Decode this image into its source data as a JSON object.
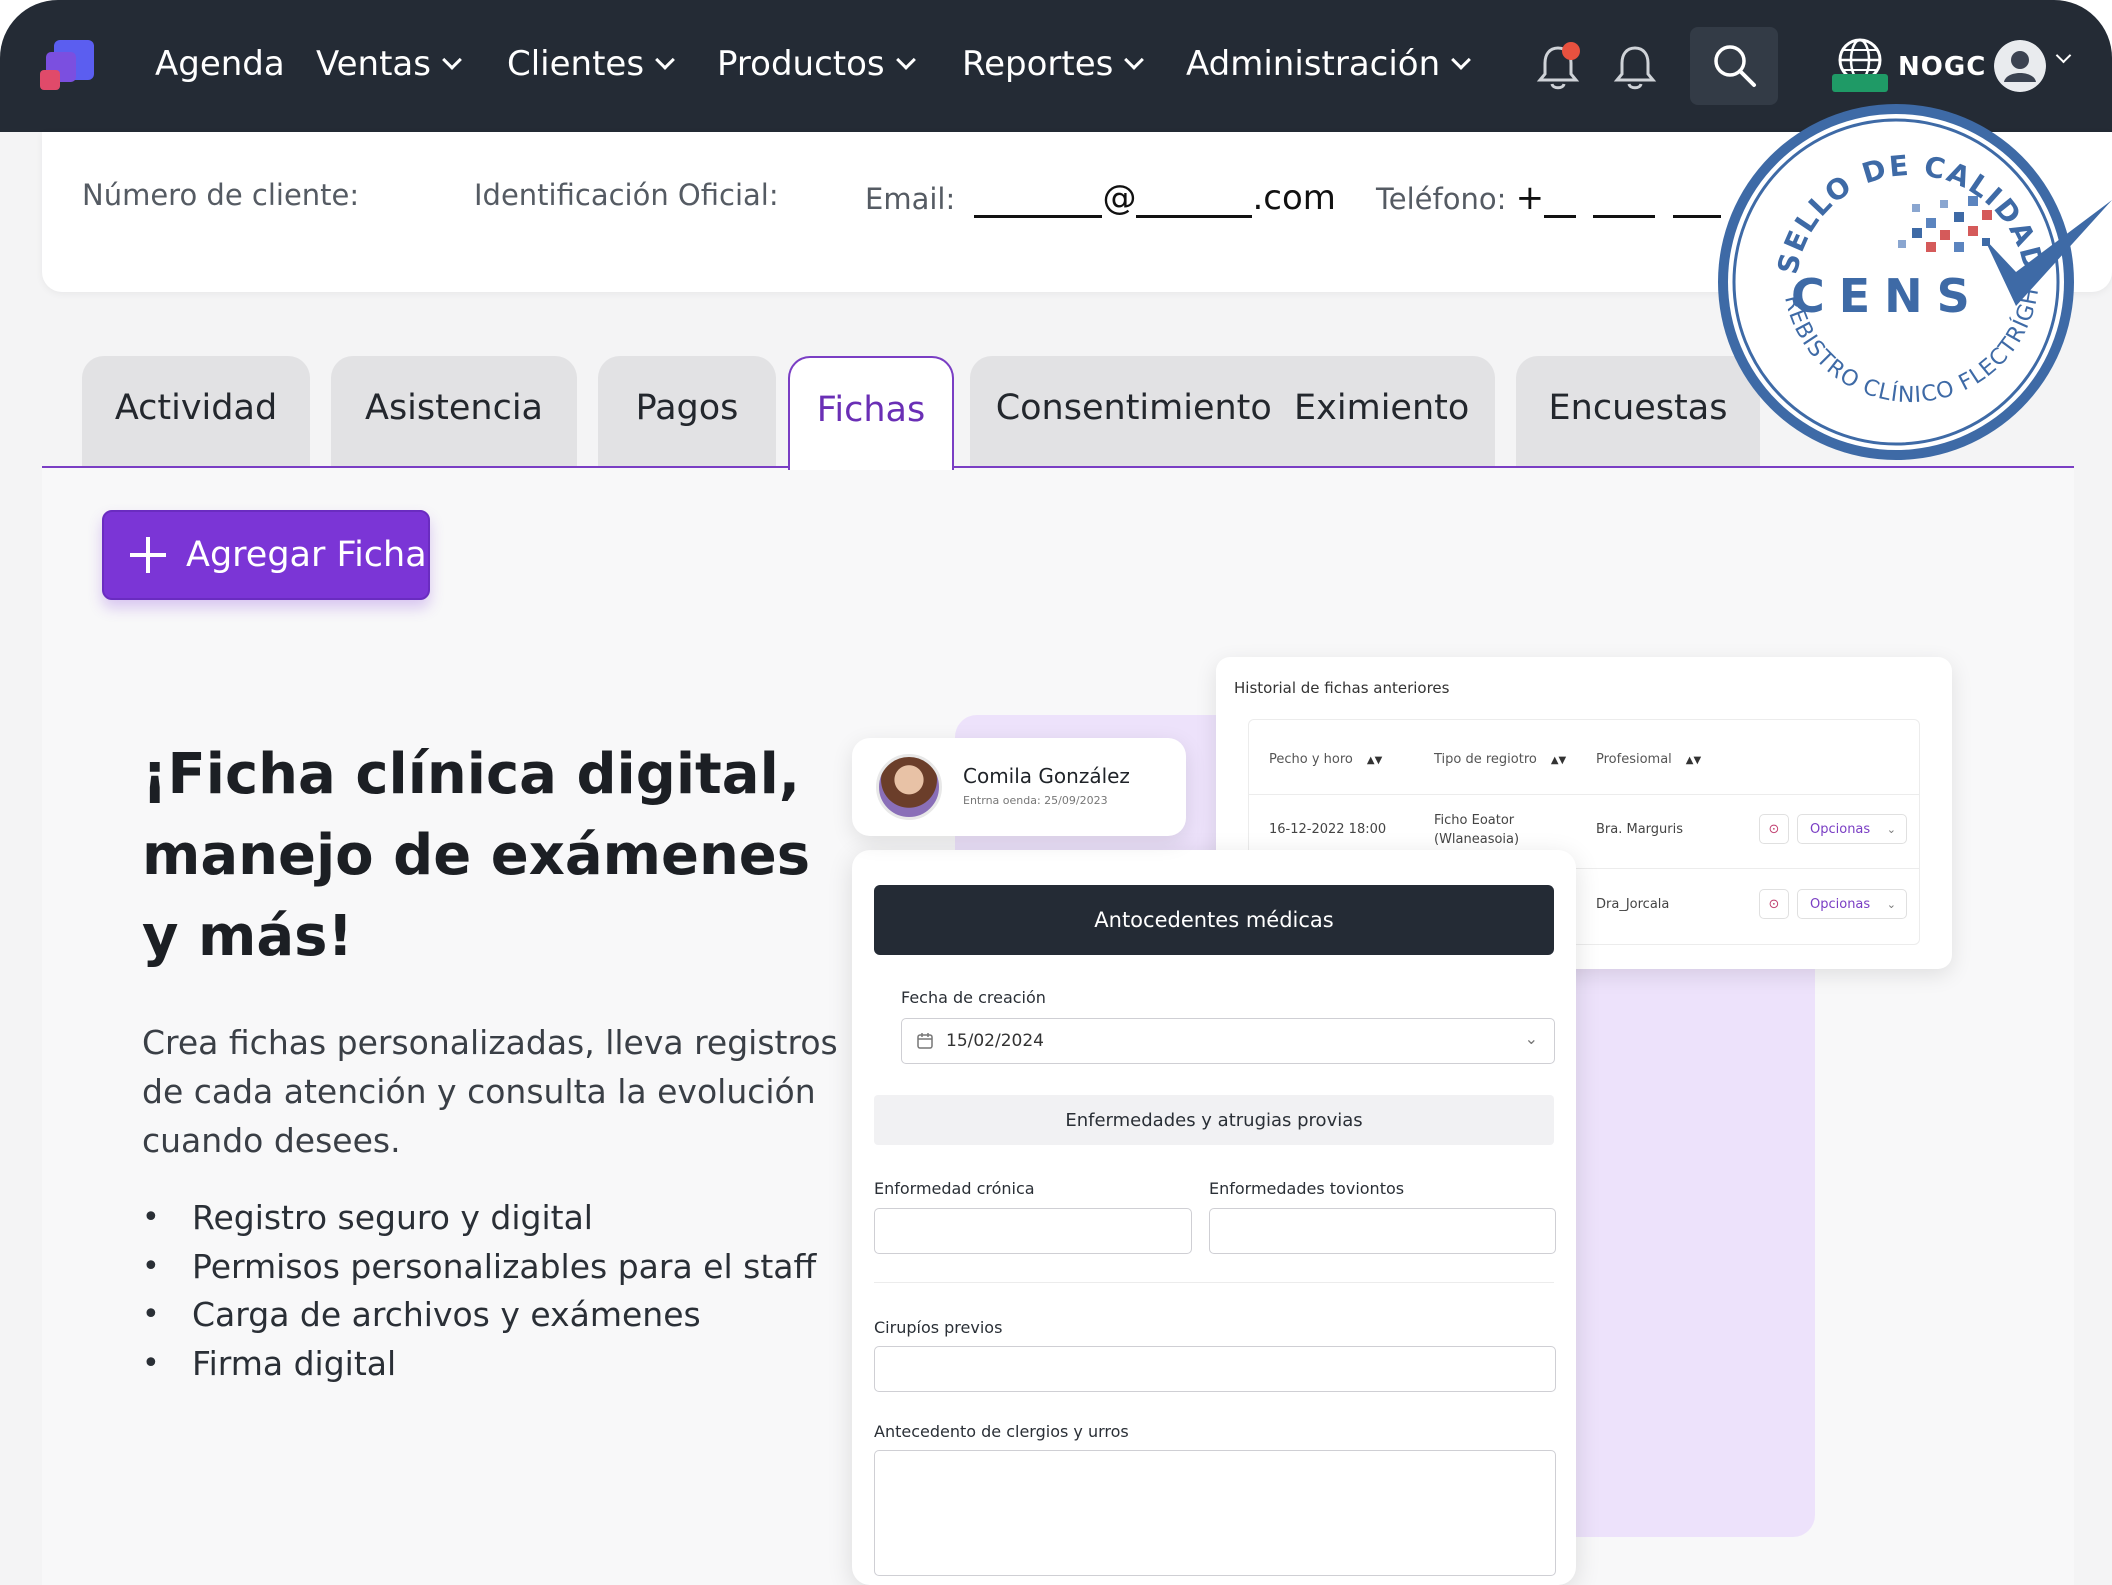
{
  "nav": {
    "items": [
      {
        "label": "Agenda",
        "dropdown": false
      },
      {
        "label": "Ventas",
        "dropdown": true
      },
      {
        "label": "Clientes",
        "dropdown": true
      },
      {
        "label": "Productos",
        "dropdown": true
      },
      {
        "label": "Reportes",
        "dropdown": true
      },
      {
        "label": "Administración",
        "dropdown": true
      }
    ],
    "lang_code": "NOGC"
  },
  "client_info": {
    "number_label": "Número de cliente:",
    "id_label": "Identificación Oficial:",
    "email_label": "Email:",
    "email_at": "@",
    "email_domain": ".com",
    "phone_label": "Teléfono:",
    "phone_prefix": "+"
  },
  "tabs": [
    {
      "label": "Actividad",
      "active": false
    },
    {
      "label": "Asistencia",
      "active": false
    },
    {
      "label": "Pagos",
      "active": false
    },
    {
      "label": "Fichas",
      "active": true
    },
    {
      "label": "Consentimiento  Eximiento",
      "active": false
    },
    {
      "label": "Encuestas",
      "active": false
    }
  ],
  "add_button": "Agregar Ficha",
  "hero": {
    "title": "¡Ficha clínica digital, manejo de exámenes y más!",
    "description": "Crea fichas personalizadas, lleva registros de cada atención y consulta la evolución cuando desees.",
    "bullets": [
      "Registro seguro y digital",
      "Permisos personalizables para el staff",
      "Carga de archivos y exámenes",
      "Firma digital"
    ]
  },
  "history": {
    "title": "Historial de fichas anteriores",
    "headers": [
      "Pecho y horo",
      "Tipo de regiotro",
      "Profesiomal"
    ],
    "rows": [
      {
        "date": "16-12-2022 18:00",
        "type": "Ficho Eoator",
        "type_sub": "(Wlaneasoia)",
        "pro": "Bra. Marguris",
        "action": "Opcionas"
      },
      {
        "date": "",
        "type": "",
        "type_sub": "",
        "pro": "Dra_Jorcala",
        "action": "Opcionas"
      }
    ]
  },
  "patient": {
    "name": "Comila González",
    "subtitle": "Entrna oenda: 25/09/2023"
  },
  "form": {
    "header": "Antocedentes médicas",
    "date_label": "Fecha de creación",
    "date_value": "15/02/2024",
    "section": "Enfermedades y atrugias provias",
    "chronic_label": "Enformedad crónica",
    "recent_label": "Enformedades toviontos",
    "surgeries_label": "Cirupíos previos",
    "background_label": "Antecedento de clergios y urros"
  },
  "seal": {
    "top_text": "SELLO DE CALIDAD",
    "brand": "CENS",
    "bottom_text": "REBISTRO CLÍNICO FLECTRÍGHITO"
  },
  "colors": {
    "accent": "#7b35d6",
    "navbar": "#242b35",
    "seal_blue": "#3e6aa6",
    "notification": "#e8513f"
  },
  "icons": [
    "bell-icon",
    "search-icon",
    "globe-icon",
    "user-icon",
    "calendar-icon",
    "chevron-down-icon",
    "plus-icon"
  ]
}
